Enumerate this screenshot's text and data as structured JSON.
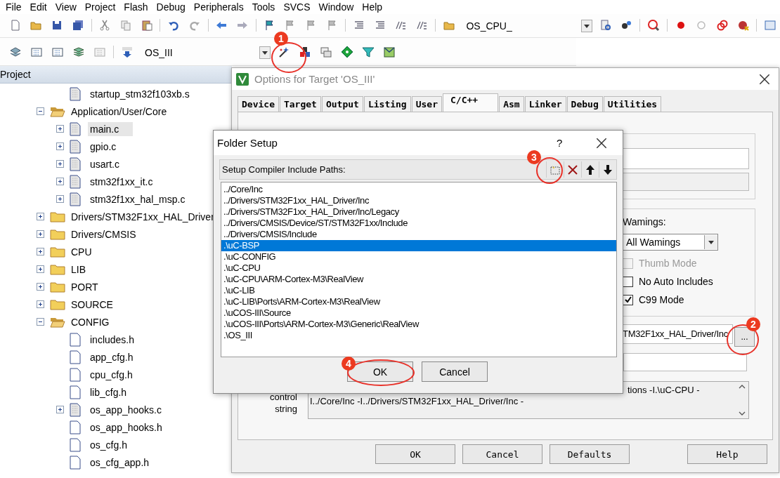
{
  "menu": [
    "File",
    "Edit",
    "View",
    "Project",
    "Flash",
    "Debug",
    "Peripherals",
    "Tools",
    "SVCS",
    "Window",
    "Help"
  ],
  "toolbar": {
    "find_combo": "OS_CPU_",
    "target_combo": "OS_III"
  },
  "project_pane": {
    "title": "Project",
    "leading_files": [
      {
        "label": "startup_stm32f103xb.s",
        "kind": "source",
        "expandable": false,
        "selected": false
      }
    ],
    "tree": [
      {
        "label": "Application/User/Core",
        "expanded": true,
        "children": [
          {
            "label": "main.c",
            "kind": "source",
            "expandable": true,
            "selected": true
          },
          {
            "label": "gpio.c",
            "kind": "source",
            "expandable": true,
            "selected": false
          },
          {
            "label": "usart.c",
            "kind": "source",
            "expandable": true,
            "selected": false
          },
          {
            "label": "stm32f1xx_it.c",
            "kind": "source",
            "expandable": true,
            "selected": false
          },
          {
            "label": "stm32f1xx_hal_msp.c",
            "kind": "source",
            "expandable": true,
            "selected": false
          }
        ]
      },
      {
        "label": "Drivers/STM32F1xx_HAL_Driver",
        "expanded": false
      },
      {
        "label": "Drivers/CMSIS",
        "expanded": false
      },
      {
        "label": "CPU",
        "expanded": false
      },
      {
        "label": "LIB",
        "expanded": false
      },
      {
        "label": "PORT",
        "expanded": false
      },
      {
        "label": "SOURCE",
        "expanded": false
      },
      {
        "label": "CONFIG",
        "expanded": true,
        "children": [
          {
            "label": "includes.h",
            "kind": "header",
            "expandable": false,
            "selected": false
          },
          {
            "label": "app_cfg.h",
            "kind": "header",
            "expandable": false,
            "selected": false
          },
          {
            "label": "cpu_cfg.h",
            "kind": "header",
            "expandable": false,
            "selected": false
          },
          {
            "label": "lib_cfg.h",
            "kind": "header",
            "expandable": false,
            "selected": false
          },
          {
            "label": "os_app_hooks.c",
            "kind": "source",
            "expandable": true,
            "selected": false
          },
          {
            "label": "os_app_hooks.h",
            "kind": "header",
            "expandable": false,
            "selected": false
          },
          {
            "label": "os_cfg.h",
            "kind": "header",
            "expandable": false,
            "selected": false
          },
          {
            "label": "os_cfg_app.h",
            "kind": "header",
            "expandable": false,
            "selected": false
          }
        ]
      }
    ]
  },
  "options_dialog": {
    "title": "Options for Target 'OS_III'",
    "tabs": [
      {
        "label": "Device",
        "selected": false
      },
      {
        "label": "Target",
        "selected": false
      },
      {
        "label": "Output",
        "selected": false
      },
      {
        "label": "Listing",
        "selected": false
      },
      {
        "label": "User",
        "selected": false
      },
      {
        "label": "C/C++",
        "selected": true
      },
      {
        "label": "Asm",
        "selected": false
      },
      {
        "label": "Linker",
        "selected": false
      },
      {
        "label": "Debug",
        "selected": false
      },
      {
        "label": "Utilities",
        "selected": false
      }
    ],
    "warnings_label": "Wamings:",
    "warnings_value": "All Wamings",
    "checkboxes": [
      {
        "label": "Thumb Mode",
        "checked": false,
        "disabled": true
      },
      {
        "label": "No Auto Includes",
        "checked": false,
        "disabled": false
      },
      {
        "label": "C99 Mode",
        "checked": true,
        "disabled": false
      }
    ],
    "include_paths_value": "TM32F1xx_HAL_Driver/Inc",
    "browse_button": "...",
    "misc_label": [
      "control",
      "string"
    ],
    "misc_lines": [
      "tions -I.\\uC-CPU -",
      "I../Core/Inc -I../Drivers/STM32F1xx_HAL_Driver/Inc -"
    ],
    "buttons": [
      "OK",
      "Cancel",
      "Defaults",
      "Help"
    ]
  },
  "folder_setup": {
    "title": "Folder Setup",
    "help": "?",
    "header": "Setup Compiler Include Paths:",
    "paths": [
      {
        "text": "../Core/Inc",
        "selected": false
      },
      {
        "text": "../Drivers/STM32F1xx_HAL_Driver/Inc",
        "selected": false
      },
      {
        "text": "../Drivers/STM32F1xx_HAL_Driver/Inc/Legacy",
        "selected": false
      },
      {
        "text": "../Drivers/CMSIS/Device/ST/STM32F1xx/Include",
        "selected": false
      },
      {
        "text": "../Drivers/CMSIS/Include",
        "selected": false
      },
      {
        "text": ".\\uC-BSP",
        "selected": true
      },
      {
        "text": ".\\uC-CONFIG",
        "selected": false
      },
      {
        "text": ".\\uC-CPU",
        "selected": false
      },
      {
        "text": ".\\uC-CPU\\ARM-Cortex-M3\\RealView",
        "selected": false
      },
      {
        "text": ".\\uC-LIB",
        "selected": false
      },
      {
        "text": ".\\uC-LIB\\Ports\\ARM-Cortex-M3\\RealView",
        "selected": false
      },
      {
        "text": ".\\uCOS-III\\Source",
        "selected": false
      },
      {
        "text": ".\\uCOS-III\\Ports\\ARM-Cortex-M3\\Generic\\RealView",
        "selected": false
      },
      {
        "text": ".\\OS_III",
        "selected": false
      }
    ],
    "buttons": [
      "OK",
      "Cancel"
    ]
  },
  "annotations": [
    {
      "label": "1"
    },
    {
      "label": "2"
    },
    {
      "label": "3"
    },
    {
      "label": "4"
    }
  ]
}
